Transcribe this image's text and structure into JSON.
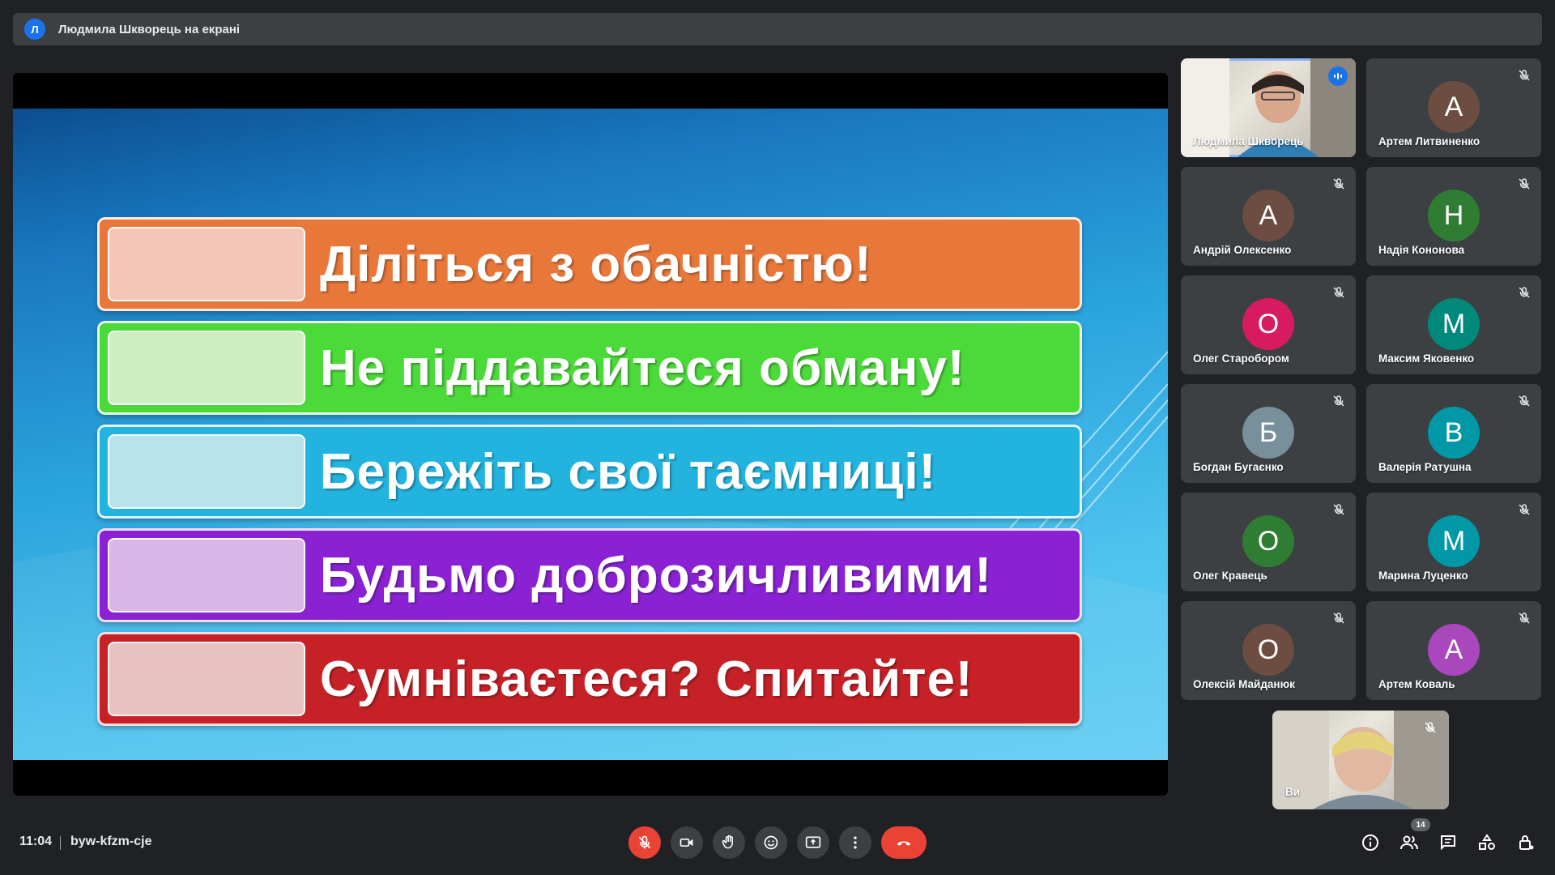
{
  "presenter_banner": {
    "avatar_letter": "Л",
    "text": "Людмила Шкворець на екрані"
  },
  "slide": {
    "bars": [
      {
        "text": "Діліться з обачністю!",
        "color": "#e8773a",
        "swatch": "#f4c6b8"
      },
      {
        "text": "Не піддавайтеся обману!",
        "color": "#4cd93a",
        "swatch": "#cdeec0"
      },
      {
        "text": "Бережіть свої таємниці!",
        "color": "#22b3df",
        "swatch": "#b8e3ea"
      },
      {
        "text": "Будьмо доброзичливими!",
        "color": "#8a22d4",
        "swatch": "#d9b6e6"
      },
      {
        "text": "Сумніваєтеся? Спитайте!",
        "color": "#c62127",
        "swatch": "#e8c1c1"
      }
    ]
  },
  "participants": [
    {
      "name": "Людмила Шкворець",
      "type": "video",
      "speaking": true
    },
    {
      "name": "Артем Литвиненко",
      "letter": "А",
      "color": "#6d4c41"
    },
    {
      "name": "Андрій Олексенко",
      "letter": "А",
      "color": "#6d4c41"
    },
    {
      "name": "Надія Кононова",
      "letter": "Н",
      "color": "#2e7d32"
    },
    {
      "name": "Олег Старобором",
      "letter": "О",
      "color": "#d81b60"
    },
    {
      "name": "Максим Яковенко",
      "letter": "М",
      "color": "#00897b"
    },
    {
      "name": "Богдан Бугаєнко",
      "letter": "Б",
      "color": "#78909c"
    },
    {
      "name": "Валерія Ратушна",
      "letter": "В",
      "color": "#0097a7"
    },
    {
      "name": "Олег Кравець",
      "letter": "О",
      "color": "#2e7d32"
    },
    {
      "name": "Марина Луценко",
      "letter": "М",
      "color": "#0097a7"
    },
    {
      "name": "Олексій Майданюк",
      "letter": "О",
      "color": "#6d4c41"
    },
    {
      "name": "Артем Коваль",
      "letter": "А",
      "color": "#ab47bc"
    }
  ],
  "self_tile": {
    "name": "Ви"
  },
  "bottombar": {
    "time": "11:04",
    "meeting_code": "byw-kfzm-cje",
    "participant_count": "14"
  },
  "colors": {
    "accent": "#8ab4f8",
    "danger": "#ea4335",
    "control_bg": "#3c4043"
  }
}
